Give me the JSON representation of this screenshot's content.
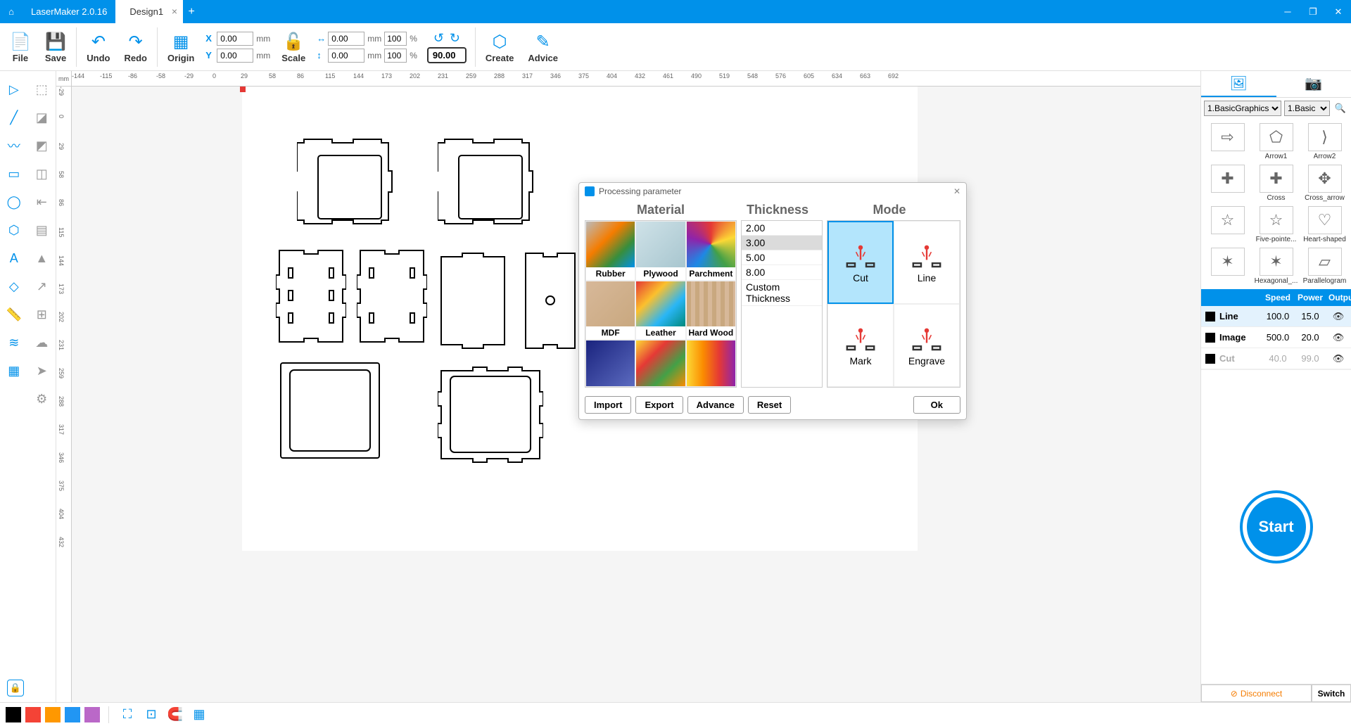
{
  "app": {
    "title": "LaserMaker 2.0.16"
  },
  "tabs": [
    {
      "label": "Design1"
    }
  ],
  "toolbar": {
    "file": "File",
    "save": "Save",
    "undo": "Undo",
    "redo": "Redo",
    "origin": "Origin",
    "scale": "Scale",
    "create": "Create",
    "advice": "Advice",
    "x_label": "X",
    "y_label": "Y",
    "x_val": "0.00",
    "y_val": "0.00",
    "mm": "mm",
    "w_val": "0.00",
    "h_val": "0.00",
    "pct_w": "100",
    "pct_h": "100",
    "pct": "%",
    "angle": "90.00"
  },
  "ruler": {
    "unit": "mm",
    "h": [
      "-144",
      "-115",
      "-86",
      "-58",
      "-29",
      "0",
      "29",
      "58",
      "86",
      "115",
      "144",
      "173",
      "202",
      "231",
      "259",
      "288",
      "317",
      "346",
      "375",
      "404",
      "432",
      "461",
      "490",
      "519",
      "548",
      "576",
      "605",
      "634",
      "663",
      "692"
    ],
    "v": [
      "-29",
      "0",
      "29",
      "58",
      "86",
      "115",
      "144",
      "173",
      "202",
      "231",
      "259",
      "288",
      "317",
      "346",
      "375",
      "404",
      "432"
    ]
  },
  "shapes_panel": {
    "select1": "1.BasicGraphics",
    "select2": "1.Basic",
    "items_row1": [
      "Arrow1",
      "Arrow2"
    ],
    "items_row2": [
      "Cross",
      "Cross_arrow"
    ],
    "items_row3": [
      "Five-pointe...",
      "Heart-shaped"
    ],
    "items_row4": [
      "Hexagonal_...",
      "Parallelogram"
    ]
  },
  "layers": {
    "headers": {
      "name": "",
      "speed": "Speed",
      "power": "Power",
      "output": "Output"
    },
    "rows": [
      {
        "name": "Line",
        "speed": "100.0",
        "power": "15.0",
        "dim": false,
        "sel": true
      },
      {
        "name": "Image",
        "speed": "500.0",
        "power": "20.0",
        "dim": false,
        "sel": false
      },
      {
        "name": "Cut",
        "speed": "40.0",
        "power": "99.0",
        "dim": true,
        "sel": false
      }
    ]
  },
  "start_label": "Start",
  "connection": {
    "disconnect": "Disconnect",
    "switch": "Switch"
  },
  "colors": [
    "#000000",
    "#f44336",
    "#ff9800",
    "#2196f3",
    "#ba68c8"
  ],
  "dialog": {
    "title": "Processing parameter",
    "h_material": "Material",
    "h_thickness": "Thickness",
    "h_mode": "Mode",
    "materials": [
      {
        "label": "Rubber",
        "bg": "linear-gradient(135deg,#bbb 0%,#f57c00 40%,#388e3c 70%,#0091ea 100%)"
      },
      {
        "label": "Plywood",
        "bg": "linear-gradient(135deg,#cfe2e8,#a8c6cf)"
      },
      {
        "label": "Parchment",
        "bg": "conic-gradient(#e53935,#fdd835,#43a047,#1e88e5,#8e24aa,#e53935)"
      },
      {
        "label": "MDF",
        "bg": "linear-gradient(135deg,#d7b899,#c9a87f)"
      },
      {
        "label": "Leather",
        "bg": "linear-gradient(135deg,#e53935,#fbc02d,#29b6f6,#00897b)"
      },
      {
        "label": "Hard Wood",
        "bg": "repeating-linear-gradient(90deg,#c9a87f 0 6px,#d7b899 6px 12px)"
      },
      {
        "label": "",
        "bg": "linear-gradient(135deg,#1a237e,#5c6bc0)"
      },
      {
        "label": "",
        "bg": "linear-gradient(135deg,#fdd835,#e53935,#43a047,#fb8c00)"
      },
      {
        "label": "",
        "bg": "linear-gradient(90deg,#fdd835,#fb8c00,#e53935,#8e24aa)"
      }
    ],
    "thickness": [
      {
        "v": "2.00",
        "sel": false
      },
      {
        "v": "3.00",
        "sel": true
      },
      {
        "v": "5.00",
        "sel": false
      },
      {
        "v": "8.00",
        "sel": false
      },
      {
        "v": "Custom Thickness",
        "sel": false
      }
    ],
    "modes": [
      {
        "label": "Cut",
        "sel": true
      },
      {
        "label": "Line",
        "sel": false
      },
      {
        "label": "Mark",
        "sel": false
      },
      {
        "label": "Engrave",
        "sel": false
      }
    ],
    "buttons": {
      "import": "Import",
      "export": "Export",
      "advance": "Advance",
      "reset": "Reset",
      "ok": "Ok"
    }
  }
}
